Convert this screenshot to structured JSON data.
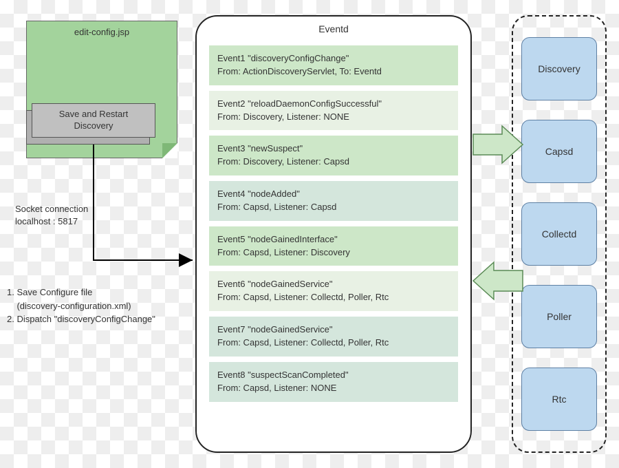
{
  "jsp": {
    "title": "edit-config.jsp",
    "button": "Save and Restart\nDiscovery"
  },
  "socket": {
    "line1": "Socket connection",
    "line2": "localhost : 5817"
  },
  "steps": {
    "s1": "1. Save Configure file",
    "s1b": "    (discovery-configuration.xml)",
    "s2": "2. Dispatch \"discoveryConfigChange\""
  },
  "eventd": {
    "title": "Eventd",
    "events": [
      {
        "l1": "Event1 \"discoveryConfigChange\"",
        "l2": "From: ActionDiscoveryServlet, To: Eventd",
        "cls": "ev-green"
      },
      {
        "l1": "Event2 \"reloadDaemonConfigSuccessful\"",
        "l2": "From: Discovery, Listener: NONE",
        "cls": "ev-light"
      },
      {
        "l1": "Event3 \"newSuspect\"",
        "l2": "From: Discovery, Listener: Capsd",
        "cls": "ev-green"
      },
      {
        "l1": "Event4 \"nodeAdded\"",
        "l2": "From: Capsd, Listener: Capsd",
        "cls": "ev-blue"
      },
      {
        "l1": "Event5 \"nodeGainedInterface\"",
        "l2": "From: Capsd, Listener: Discovery",
        "cls": "ev-green"
      },
      {
        "l1": "Event6 \"nodeGainedService\"",
        "l2": "From: Capsd, Listener: Collectd, Poller, Rtc",
        "cls": "ev-light"
      },
      {
        "l1": "Event7 \"nodeGainedService\"",
        "l2": "From: Capsd, Listener: Collectd, Poller, Rtc",
        "cls": "ev-blue"
      },
      {
        "l1": "Event8 \"suspectScanCompleted\"",
        "l2": "From: Capsd, Listener: NONE",
        "cls": "ev-blue"
      }
    ]
  },
  "services": [
    "Discovery",
    "Capsd",
    "Collectd",
    "Poller",
    "Rtc"
  ]
}
